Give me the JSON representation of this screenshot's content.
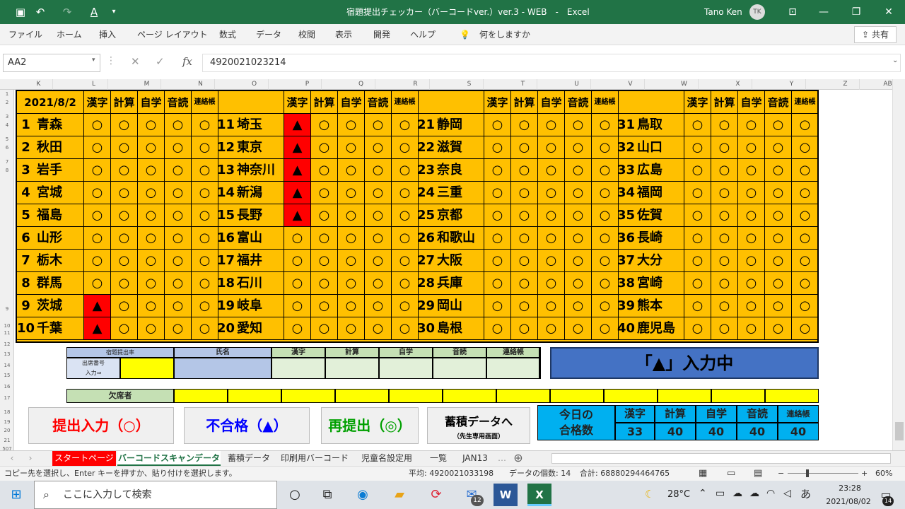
{
  "window": {
    "title": "宿題提出チェッカー（バーコードver.）ver.3 - WEB　-　Excel",
    "user": "Tano Ken",
    "avatar": "TK"
  },
  "ribbon": {
    "tabs": [
      "ファイル",
      "ホーム",
      "挿入",
      "ページ レイアウト",
      "数式",
      "データ",
      "校閲",
      "表示",
      "開発",
      "ヘルプ"
    ],
    "tell_me": "何をしますか",
    "share": "共有"
  },
  "formula": {
    "name_box": "AA2",
    "value": "4920021023214"
  },
  "columns": [
    "K",
    "L",
    "M",
    "N",
    "O",
    "P",
    "Q",
    "R",
    "S",
    "T",
    "U",
    "V",
    "W",
    "X",
    "Y",
    "Z",
    "AB"
  ],
  "rows": [
    "1",
    "2",
    "3",
    "4",
    "5",
    "6",
    "7",
    "8",
    "9",
    "10",
    "11",
    "12",
    "13",
    "14",
    "15",
    "16",
    "17",
    "18",
    "19",
    "20",
    "21",
    "507"
  ],
  "table": {
    "date": "2021/8/2",
    "subjects": [
      "漢字",
      "計算",
      "自学",
      "音読",
      "連絡帳"
    ],
    "groups": [
      {
        "students": [
          {
            "no": "1",
            "name": "青森",
            "marks": [
              "○",
              "○",
              "○",
              "○",
              "○"
            ]
          },
          {
            "no": "2",
            "name": "秋田",
            "marks": [
              "○",
              "○",
              "○",
              "○",
              "○"
            ]
          },
          {
            "no": "3",
            "name": "岩手",
            "marks": [
              "○",
              "○",
              "○",
              "○",
              "○"
            ]
          },
          {
            "no": "4",
            "name": "宮城",
            "marks": [
              "○",
              "○",
              "○",
              "○",
              "○"
            ]
          },
          {
            "no": "5",
            "name": "福島",
            "marks": [
              "○",
              "○",
              "○",
              "○",
              "○"
            ]
          },
          {
            "no": "6",
            "name": "山形",
            "marks": [
              "○",
              "○",
              "○",
              "○",
              "○"
            ]
          },
          {
            "no": "7",
            "name": "栃木",
            "marks": [
              "○",
              "○",
              "○",
              "○",
              "○"
            ]
          },
          {
            "no": "8",
            "name": "群馬",
            "marks": [
              "○",
              "○",
              "○",
              "○",
              "○"
            ]
          },
          {
            "no": "9",
            "name": "茨城",
            "marks": [
              "▲",
              "○",
              "○",
              "○",
              "○"
            ]
          },
          {
            "no": "10",
            "name": "千葉",
            "marks": [
              "▲",
              "○",
              "○",
              "○",
              "○"
            ]
          }
        ]
      },
      {
        "students": [
          {
            "no": "11",
            "name": "埼玉",
            "marks": [
              "▲",
              "○",
              "○",
              "○",
              "○"
            ]
          },
          {
            "no": "12",
            "name": "東京",
            "marks": [
              "▲",
              "○",
              "○",
              "○",
              "○"
            ]
          },
          {
            "no": "13",
            "name": "神奈川",
            "marks": [
              "▲",
              "○",
              "○",
              "○",
              "○"
            ]
          },
          {
            "no": "14",
            "name": "新潟",
            "marks": [
              "▲",
              "○",
              "○",
              "○",
              "○"
            ]
          },
          {
            "no": "15",
            "name": "長野",
            "marks": [
              "▲",
              "○",
              "○",
              "○",
              "○"
            ]
          },
          {
            "no": "16",
            "name": "富山",
            "marks": [
              "○",
              "○",
              "○",
              "○",
              "○"
            ]
          },
          {
            "no": "17",
            "name": "福井",
            "marks": [
              "○",
              "○",
              "○",
              "○",
              "○"
            ]
          },
          {
            "no": "18",
            "name": "石川",
            "marks": [
              "○",
              "○",
              "○",
              "○",
              "○"
            ]
          },
          {
            "no": "19",
            "name": "岐阜",
            "marks": [
              "○",
              "○",
              "○",
              "○",
              "○"
            ]
          },
          {
            "no": "20",
            "name": "愛知",
            "marks": [
              "○",
              "○",
              "○",
              "○",
              "○"
            ]
          }
        ]
      },
      {
        "students": [
          {
            "no": "21",
            "name": "静岡",
            "marks": [
              "○",
              "○",
              "○",
              "○",
              "○"
            ]
          },
          {
            "no": "22",
            "name": "滋賀",
            "marks": [
              "○",
              "○",
              "○",
              "○",
              "○"
            ]
          },
          {
            "no": "23",
            "name": "奈良",
            "marks": [
              "○",
              "○",
              "○",
              "○",
              "○"
            ]
          },
          {
            "no": "24",
            "name": "三重",
            "marks": [
              "○",
              "○",
              "○",
              "○",
              "○"
            ]
          },
          {
            "no": "25",
            "name": "京都",
            "marks": [
              "○",
              "○",
              "○",
              "○",
              "○"
            ]
          },
          {
            "no": "26",
            "name": "和歌山",
            "marks": [
              "○",
              "○",
              "○",
              "○",
              "○"
            ]
          },
          {
            "no": "27",
            "name": "大阪",
            "marks": [
              "○",
              "○",
              "○",
              "○",
              "○"
            ]
          },
          {
            "no": "28",
            "name": "兵庫",
            "marks": [
              "○",
              "○",
              "○",
              "○",
              "○"
            ]
          },
          {
            "no": "29",
            "name": "岡山",
            "marks": [
              "○",
              "○",
              "○",
              "○",
              "○"
            ]
          },
          {
            "no": "30",
            "name": "島根",
            "marks": [
              "○",
              "○",
              "○",
              "○",
              "○"
            ]
          }
        ]
      },
      {
        "students": [
          {
            "no": "31",
            "name": "鳥取",
            "marks": [
              "○",
              "○",
              "○",
              "○",
              "○"
            ]
          },
          {
            "no": "32",
            "name": "山口",
            "marks": [
              "○",
              "○",
              "○",
              "○",
              "○"
            ]
          },
          {
            "no": "33",
            "name": "広島",
            "marks": [
              "○",
              "○",
              "○",
              "○",
              "○"
            ]
          },
          {
            "no": "34",
            "name": "福岡",
            "marks": [
              "○",
              "○",
              "○",
              "○",
              "○"
            ]
          },
          {
            "no": "35",
            "name": "佐賀",
            "marks": [
              "○",
              "○",
              "○",
              "○",
              "○"
            ]
          },
          {
            "no": "36",
            "name": "長崎",
            "marks": [
              "○",
              "○",
              "○",
              "○",
              "○"
            ]
          },
          {
            "no": "37",
            "name": "大分",
            "marks": [
              "○",
              "○",
              "○",
              "○",
              "○"
            ]
          },
          {
            "no": "38",
            "name": "宮崎",
            "marks": [
              "○",
              "○",
              "○",
              "○",
              "○"
            ]
          },
          {
            "no": "39",
            "name": "熊本",
            "marks": [
              "○",
              "○",
              "○",
              "○",
              "○"
            ]
          },
          {
            "no": "40",
            "name": "鹿児島",
            "marks": [
              "○",
              "○",
              "○",
              "○",
              "○"
            ]
          }
        ]
      }
    ]
  },
  "input_panel": {
    "rate_label": "宿題提出率",
    "seat_label": "出席番号",
    "input_label": "入力⇒",
    "name_header": "氏名",
    "subjects": [
      "漢字",
      "計算",
      "自学",
      "音読",
      "連絡帳"
    ]
  },
  "mode_banner": "「▲」入力中",
  "absent_label": "欠席者",
  "buttons": {
    "submit": "提出入力（○）",
    "fail": "不合格（▲）",
    "resubmit": "再提出（◎）",
    "archive": "蓄積データへ",
    "archive_sub": "（先生専用画面）"
  },
  "today": {
    "label1": "今日の",
    "label2": "合格数",
    "subjects": [
      "漢字",
      "計算",
      "自学",
      "音読",
      "連絡帳"
    ],
    "counts": [
      "33",
      "40",
      "40",
      "40",
      "40"
    ]
  },
  "sheet_tabs": [
    "スタートページ",
    "バーコードスキャンデータ",
    "蓄積データ",
    "印刷用バーコード",
    "児童名設定用",
    "一覧",
    "JAN13"
  ],
  "status": {
    "message": "コピー先を選択し、Enter キーを押すか、貼り付けを選択します。",
    "average": "平均: 4920021033198",
    "count": "データの個数: 14",
    "sum": "合計: 68880294464765",
    "zoom": "60%"
  },
  "taskbar": {
    "search": "ここに入力して検索",
    "temp": "28°C",
    "time": "23:28",
    "date": "2021/08/02",
    "mail_badge": "12",
    "notify_badge": "14",
    "ime": "あ"
  },
  "colors": {
    "excel_green": "#217346",
    "grid_fill": "#ffc000",
    "red": "#ff0000",
    "blue_banner": "#4472c4",
    "cyan": "#00b0f0",
    "yellow": "#ffff00"
  }
}
